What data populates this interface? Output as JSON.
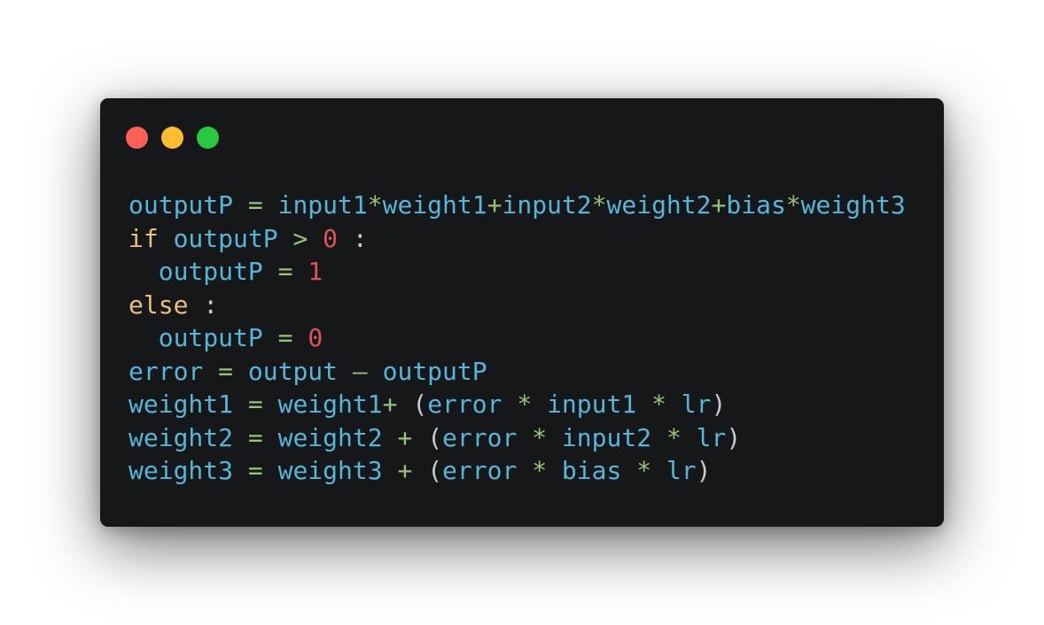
{
  "window": {
    "controls": [
      {
        "name": "close-control",
        "color": "#ff5f57"
      },
      {
        "name": "minimize-control",
        "color": "#febc2e"
      },
      {
        "name": "zoom-control",
        "color": "#28c840"
      }
    ]
  },
  "theme": {
    "background": "#161719",
    "identifier": "#56b6d9",
    "keyword": "#e6c07b",
    "operator": "#98c379",
    "number": "#e0525a",
    "punctuation": "#c9cbcf"
  },
  "code": {
    "lines": [
      [
        {
          "t": "ident",
          "v": "outputP"
        },
        {
          "t": "ws",
          "v": " "
        },
        {
          "t": "op",
          "v": "="
        },
        {
          "t": "ws",
          "v": " "
        },
        {
          "t": "ident",
          "v": "input1"
        },
        {
          "t": "op",
          "v": "*"
        },
        {
          "t": "ident",
          "v": "weight1"
        },
        {
          "t": "op",
          "v": "+"
        },
        {
          "t": "ident",
          "v": "input2"
        },
        {
          "t": "op",
          "v": "*"
        },
        {
          "t": "ident",
          "v": "weight2"
        },
        {
          "t": "op",
          "v": "+"
        },
        {
          "t": "ident",
          "v": "bias"
        },
        {
          "t": "op",
          "v": "*"
        },
        {
          "t": "ident",
          "v": "weight3"
        }
      ],
      [
        {
          "t": "kw",
          "v": "if"
        },
        {
          "t": "ws",
          "v": " "
        },
        {
          "t": "ident",
          "v": "outputP"
        },
        {
          "t": "ws",
          "v": " "
        },
        {
          "t": "op",
          "v": ">"
        },
        {
          "t": "ws",
          "v": " "
        },
        {
          "t": "num",
          "v": "0"
        },
        {
          "t": "ws",
          "v": " "
        },
        {
          "t": "punc",
          "v": ":"
        }
      ],
      [
        {
          "t": "ws",
          "v": "  "
        },
        {
          "t": "ident",
          "v": "outputP"
        },
        {
          "t": "ws",
          "v": " "
        },
        {
          "t": "op",
          "v": "="
        },
        {
          "t": "ws",
          "v": " "
        },
        {
          "t": "num",
          "v": "1"
        }
      ],
      [
        {
          "t": "kw",
          "v": "else"
        },
        {
          "t": "ws",
          "v": " "
        },
        {
          "t": "punc",
          "v": ":"
        }
      ],
      [
        {
          "t": "ws",
          "v": "  "
        },
        {
          "t": "ident",
          "v": "outputP"
        },
        {
          "t": "ws",
          "v": " "
        },
        {
          "t": "op",
          "v": "="
        },
        {
          "t": "ws",
          "v": " "
        },
        {
          "t": "num",
          "v": "0"
        }
      ],
      [
        {
          "t": "ident",
          "v": "error"
        },
        {
          "t": "ws",
          "v": " "
        },
        {
          "t": "op",
          "v": "="
        },
        {
          "t": "ws",
          "v": " "
        },
        {
          "t": "ident",
          "v": "output"
        },
        {
          "t": "ws",
          "v": " "
        },
        {
          "t": "op",
          "v": "–"
        },
        {
          "t": "ws",
          "v": " "
        },
        {
          "t": "ident",
          "v": "outputP"
        }
      ],
      [
        {
          "t": "ident",
          "v": "weight1"
        },
        {
          "t": "ws",
          "v": " "
        },
        {
          "t": "op",
          "v": "="
        },
        {
          "t": "ws",
          "v": " "
        },
        {
          "t": "ident",
          "v": "weight1"
        },
        {
          "t": "op",
          "v": "+"
        },
        {
          "t": "ws",
          "v": " "
        },
        {
          "t": "punc",
          "v": "("
        },
        {
          "t": "ident",
          "v": "error"
        },
        {
          "t": "ws",
          "v": " "
        },
        {
          "t": "op",
          "v": "*"
        },
        {
          "t": "ws",
          "v": " "
        },
        {
          "t": "ident",
          "v": "input1"
        },
        {
          "t": "ws",
          "v": " "
        },
        {
          "t": "op",
          "v": "*"
        },
        {
          "t": "ws",
          "v": " "
        },
        {
          "t": "ident",
          "v": "lr"
        },
        {
          "t": "punc",
          "v": ")"
        }
      ],
      [
        {
          "t": "ident",
          "v": "weight2"
        },
        {
          "t": "ws",
          "v": " "
        },
        {
          "t": "op",
          "v": "="
        },
        {
          "t": "ws",
          "v": " "
        },
        {
          "t": "ident",
          "v": "weight2"
        },
        {
          "t": "ws",
          "v": " "
        },
        {
          "t": "op",
          "v": "+"
        },
        {
          "t": "ws",
          "v": " "
        },
        {
          "t": "punc",
          "v": "("
        },
        {
          "t": "ident",
          "v": "error"
        },
        {
          "t": "ws",
          "v": " "
        },
        {
          "t": "op",
          "v": "*"
        },
        {
          "t": "ws",
          "v": " "
        },
        {
          "t": "ident",
          "v": "input2"
        },
        {
          "t": "ws",
          "v": " "
        },
        {
          "t": "op",
          "v": "*"
        },
        {
          "t": "ws",
          "v": " "
        },
        {
          "t": "ident",
          "v": "lr"
        },
        {
          "t": "punc",
          "v": ")"
        }
      ],
      [
        {
          "t": "ident",
          "v": "weight3"
        },
        {
          "t": "ws",
          "v": " "
        },
        {
          "t": "op",
          "v": "="
        },
        {
          "t": "ws",
          "v": " "
        },
        {
          "t": "ident",
          "v": "weight3"
        },
        {
          "t": "ws",
          "v": " "
        },
        {
          "t": "op",
          "v": "+"
        },
        {
          "t": "ws",
          "v": " "
        },
        {
          "t": "punc",
          "v": "("
        },
        {
          "t": "ident",
          "v": "error"
        },
        {
          "t": "ws",
          "v": " "
        },
        {
          "t": "op",
          "v": "*"
        },
        {
          "t": "ws",
          "v": " "
        },
        {
          "t": "ident",
          "v": "bias"
        },
        {
          "t": "ws",
          "v": " "
        },
        {
          "t": "op",
          "v": "*"
        },
        {
          "t": "ws",
          "v": " "
        },
        {
          "t": "ident",
          "v": "lr"
        },
        {
          "t": "punc",
          "v": ")"
        }
      ]
    ]
  }
}
